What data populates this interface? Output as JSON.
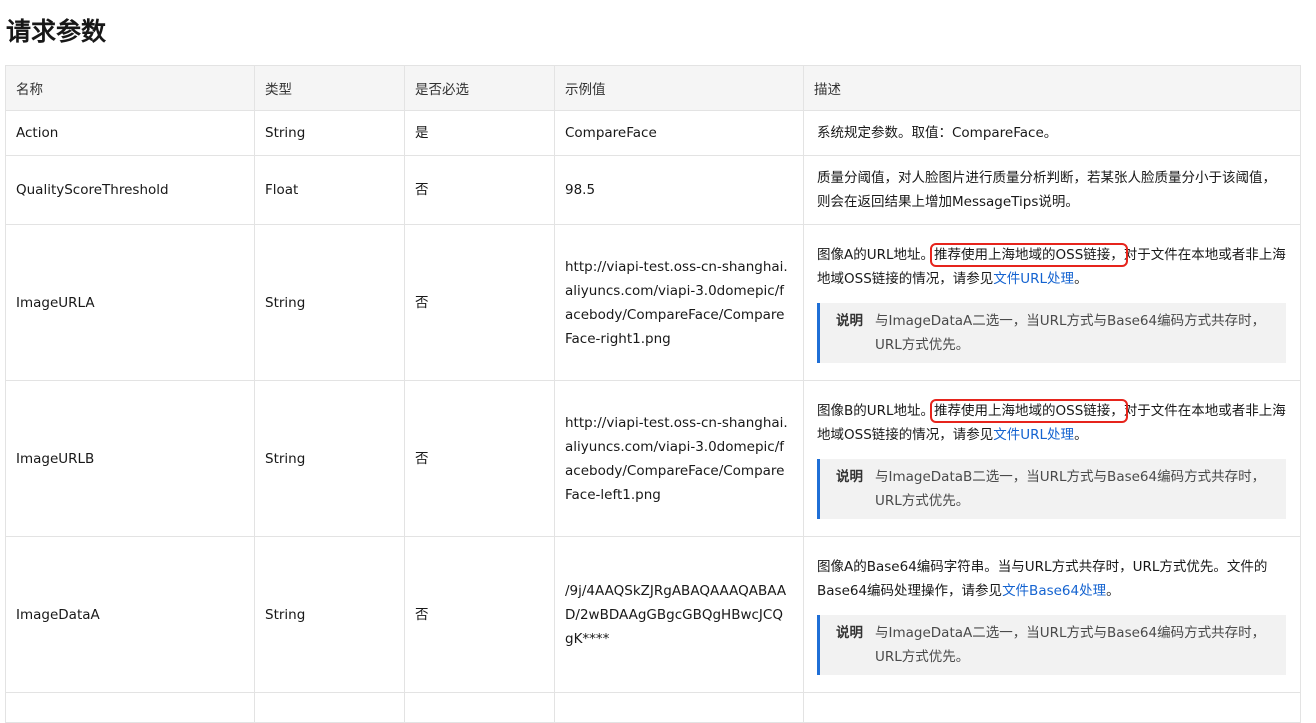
{
  "heading": "请求参数",
  "columns": [
    "名称",
    "类型",
    "是否必选",
    "示例值",
    "描述"
  ],
  "rows": [
    {
      "name": "Action",
      "type": "String",
      "required": "是",
      "example": "CompareFace",
      "desc": "系统规定参数。取值：CompareFace。"
    },
    {
      "name": "QualityScoreThreshold",
      "type": "Float",
      "required": "否",
      "example": "98.5",
      "desc": "质量分阈值，对人脸图片进行质量分析判断，若某张人脸质量分小于该阈值，则会在返回结果上增加MessageTips说明。"
    },
    {
      "name": "ImageURLA",
      "type": "String",
      "required": "否",
      "example": "http://viapi-test.oss-cn-shanghai.aliyuncs.com/viapi-3.0domepic/facebody/CompareFace/CompareFace-right1.png",
      "desc_prefix": "图像A的URL地址。",
      "desc_highlight": "推荐使用上海地域的OSS链接，",
      "desc_mid": "对于文件在本地或者非上海地域OSS链接的情况，请参见",
      "desc_link": "文件URL处理",
      "desc_end": "。",
      "note_label": "说明",
      "note_text": "与ImageDataA二选一，当URL方式与Base64编码方式共存时，URL方式优先。"
    },
    {
      "name": "ImageURLB",
      "type": "String",
      "required": "否",
      "example": "http://viapi-test.oss-cn-shanghai.aliyuncs.com/viapi-3.0domepic/facebody/CompareFace/CompareFace-left1.png",
      "desc_prefix": "图像B的URL地址。",
      "desc_highlight": "推荐使用上海地域的OSS链接，",
      "desc_mid": "对于文件在本地或者非上海地域OSS链接的情况，请参见",
      "desc_link": "文件URL处理",
      "desc_end": "。",
      "note_label": "说明",
      "note_text": "与ImageDataB二选一，当URL方式与Base64编码方式共存时，URL方式优先。"
    },
    {
      "name": "ImageDataA",
      "type": "String",
      "required": "否",
      "example": "/9j/4AAQSkZJRgABAQAAAQABAAD/2wBDAAgGBgcGBQgHBwcJCQgK****",
      "desc_prefix": "图像A的Base64编码字符串。当与URL方式共存时，URL方式优先。文件的Base64编码处理操作，请参见",
      "desc_link": "文件Base64处理",
      "desc_end": "。",
      "note_label": "说明",
      "note_text": "与ImageDataA二选一，当URL方式与Base64编码方式共存时，URL方式优先。"
    }
  ],
  "colors": {
    "highlight_box": "#e6241c",
    "link": "#1463d0",
    "note_bar": "#1f6fd6"
  }
}
